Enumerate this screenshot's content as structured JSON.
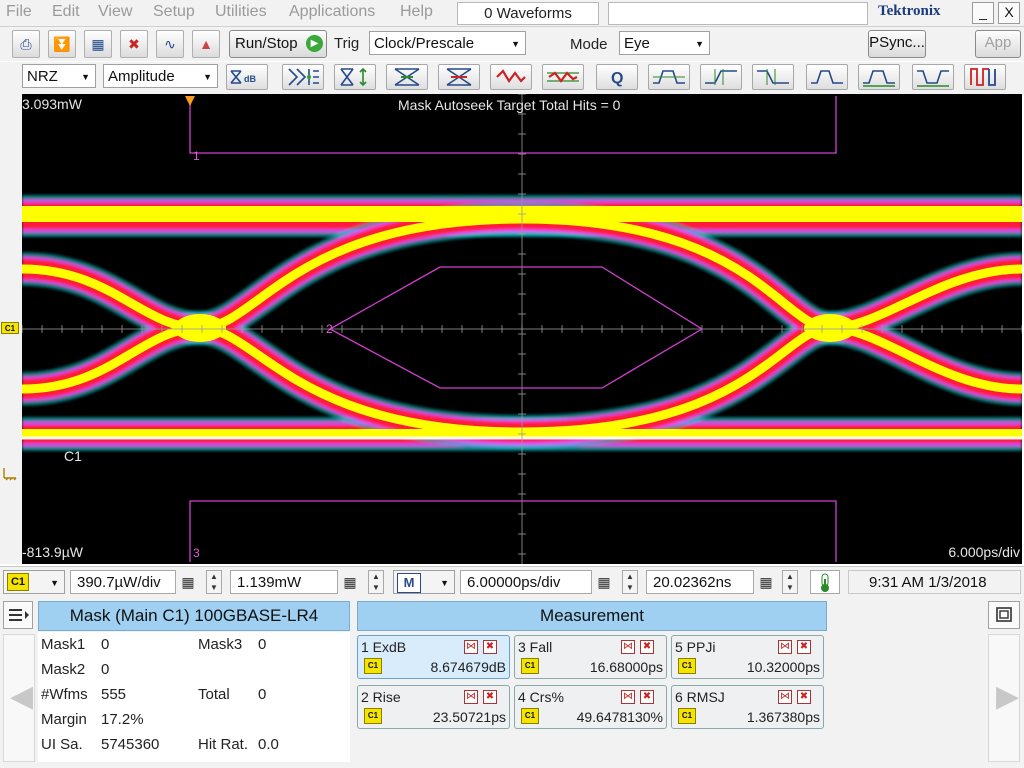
{
  "menu": {
    "items": [
      "File",
      "Edit",
      "View",
      "Setup",
      "Utilities",
      "Applications",
      "Help"
    ],
    "waveforms": "0 Waveforms",
    "brand": "Tektronix",
    "minimize": "_",
    "close": "X"
  },
  "toolbar": {
    "run_stop": "Run/Stop",
    "trig_label": "Trig",
    "trig_value": "Clock/Prescale",
    "mode_label": "Mode",
    "mode_value": "Eye",
    "psync": "PSync...",
    "app": "App"
  },
  "toolbar2": {
    "pattern": "NRZ",
    "measurement_type": "Amplitude",
    "exdb_label": "dB"
  },
  "scope": {
    "top_level": "3.093mW",
    "bottom_level": "-813.9µW",
    "timebase": "6.000ps/div",
    "autoseek": "Mask Autoseek Target Total Hits = 0",
    "channel_label": "C1",
    "channel_marker": "C1",
    "mask_labels": [
      "1",
      "2",
      "3"
    ]
  },
  "status": {
    "channel": "C1",
    "vscale": "390.7µW/div",
    "offset": "1.139mW",
    "math": "M",
    "hscale": "6.00000ps/div",
    "position": "20.02362ns",
    "clock": "9:31 AM 1/3/2018"
  },
  "mask_panel": {
    "title": "Mask (Main  C1) 100GBASE-LR4",
    "rows": [
      {
        "label": "Mask1",
        "value": "0",
        "label2": "Mask3",
        "value2": "0"
      },
      {
        "label": "Mask2",
        "value": "0",
        "label2": "",
        "value2": ""
      },
      {
        "label": "#Wfms",
        "value": "555",
        "label2": "Total",
        "value2": "0"
      },
      {
        "label": "Margin",
        "value": "17.2%",
        "label2": "",
        "value2": ""
      },
      {
        "label": "UI Sa.",
        "value": "5745360",
        "label2": "Hit Rat.",
        "value2": "0.0"
      }
    ]
  },
  "measurement_panel": {
    "title": "Measurement",
    "badge": "C1",
    "cards": [
      {
        "name": "1 ExdB",
        "value": "8.674679dB"
      },
      {
        "name": "3 Fall",
        "value": "16.68000ps"
      },
      {
        "name": "5 PPJi",
        "value": "10.32000ps"
      },
      {
        "name": "2 Rise",
        "value": "23.50721ps"
      },
      {
        "name": "4 Crs%",
        "value": "49.6478130%"
      },
      {
        "name": "6 RMSJ",
        "value": "1.367380ps"
      }
    ]
  },
  "colors": {
    "display_bg": "#000000",
    "eye_yellow": "#ffff00",
    "eye_red": "#ff1a3a",
    "eye_magenta": "#ff40ff",
    "eye_cyan": "#00d8e0",
    "mask": "#d040d0",
    "header_blue": "#9fd0f2",
    "badge_yellow": "#f4e400"
  }
}
